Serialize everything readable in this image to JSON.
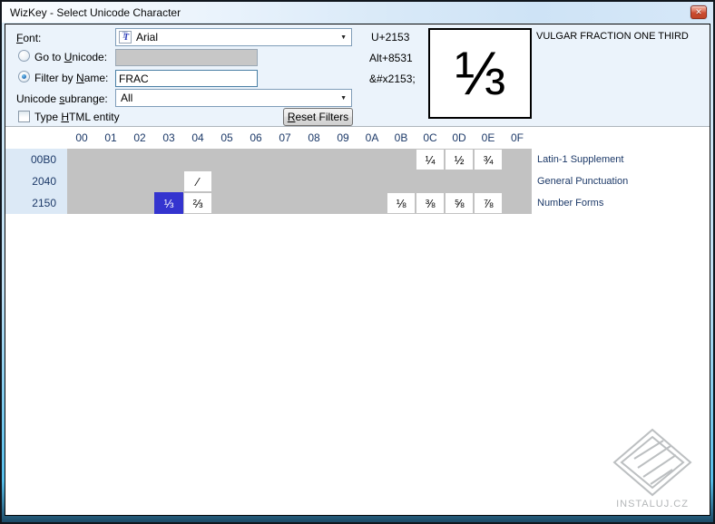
{
  "window": {
    "title": "WizKey - Select Unicode Character",
    "close_glyph": "✕"
  },
  "colors": {
    "selected_cell": "#3434cf",
    "grid_background": "#c2c2c2",
    "row_header_background": "#dce9f6",
    "panel_background": "#ebf3fb",
    "close_button_red": "#c04527",
    "frame_glass_blue": "#57bfeb"
  },
  "form": {
    "font": {
      "label_pre": "",
      "label_accel": "F",
      "label_post": "ont:",
      "value": "Arial"
    },
    "goto_unicode": {
      "label_pre": "Go to ",
      "label_accel": "U",
      "label_post": "nicode:",
      "value": "",
      "selected": false
    },
    "filter_by_name": {
      "label_pre": "Filter by ",
      "label_accel": "N",
      "label_post": "ame:",
      "value": "FRAC",
      "selected": true
    },
    "subrange": {
      "label_pre": "Unicode ",
      "label_accel": "s",
      "label_post": "ubrange:",
      "value": "All"
    },
    "html_entity": {
      "label_pre": "Type ",
      "label_accel": "H",
      "label_post": "TML entity",
      "checked": false
    },
    "reset": {
      "label_accel": "R",
      "label_post": "eset Filters"
    }
  },
  "char_info": {
    "codepoint": "U+2153",
    "alt_code": "Alt+8531",
    "html_entity": "&#x2153;",
    "glyph": "⅓",
    "name": "VULGAR FRACTION ONE THIRD"
  },
  "grid": {
    "col_headers": [
      "00",
      "01",
      "02",
      "03",
      "04",
      "05",
      "06",
      "07",
      "08",
      "09",
      "0A",
      "0B",
      "0C",
      "0D",
      "0E",
      "0F"
    ],
    "rows": [
      {
        "header": "00B0",
        "label": "Latin-1 Supplement",
        "cells": [
          {
            "col": 12,
            "char": "¼"
          },
          {
            "col": 13,
            "char": "½"
          },
          {
            "col": 14,
            "char": "¾"
          }
        ]
      },
      {
        "header": "2040",
        "label": "General Punctuation",
        "cells": [
          {
            "col": 4,
            "char": "⁄"
          }
        ]
      },
      {
        "header": "2150",
        "label": "Number Forms",
        "cells": [
          {
            "col": 3,
            "char": "⅓",
            "selected": true
          },
          {
            "col": 4,
            "char": "⅔"
          },
          {
            "col": 11,
            "char": "⅛"
          },
          {
            "col": 12,
            "char": "⅜"
          },
          {
            "col": 13,
            "char": "⅝"
          },
          {
            "col": 14,
            "char": "⅞"
          }
        ]
      }
    ]
  },
  "watermark": {
    "text": "INSTALUJ.CZ"
  }
}
